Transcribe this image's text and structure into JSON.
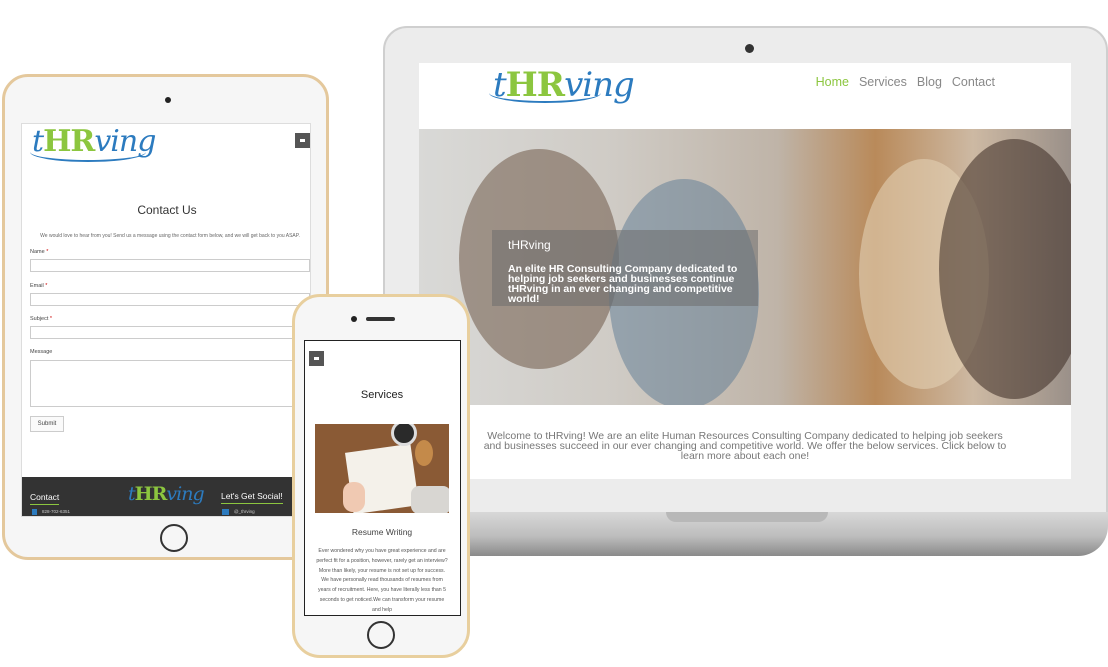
{
  "brand": {
    "logo_pre": "t",
    "logo_hr": "HR",
    "logo_post": "ving"
  },
  "laptop": {
    "nav": [
      {
        "label": "Home",
        "active": true
      },
      {
        "label": "Services",
        "active": false
      },
      {
        "label": "Blog",
        "active": false
      },
      {
        "label": "Contact",
        "active": false
      }
    ],
    "hero": {
      "title": "tHRving",
      "description": "An elite HR Consulting Company dedicated to helping job seekers and businesses continue tHRving in an ever changing and competitive world!"
    },
    "welcome": "Welcome to tHRving! We are an elite Human Resources Consulting Company dedicated to helping job seekers and businesses succeed in our ever changing and competitive world. We offer the below services. Click below to learn more about each one!"
  },
  "tablet": {
    "page_title": "Contact Us",
    "intro": "We would love to hear from you! Send us a message using the contact form below, and we will get back to you ASAP.",
    "fields": {
      "name_label": "Name",
      "email_label": "Email",
      "subject_label": "Subject",
      "message_label": "Message",
      "required_mark": "*"
    },
    "submit_label": "Submit",
    "footer": {
      "contact_heading": "Contact",
      "phone": "828-702-6351",
      "social_heading": "Let's Get Social!",
      "social_handle": "@_thrving"
    }
  },
  "phone": {
    "section_title": "Services",
    "service_name": "Resume Writing",
    "service_description": "Ever wondered why you have great experience and are perfect fit for a position, however, rarely get an interview? More than likely, your resume is not set up for success. We have personally read thousands of resumes from years of recruitment. Here, you have literally less than 5 seconds to get noticed.We can transform your resume and help"
  },
  "colors": {
    "brand_blue": "#2c7bbf",
    "brand_green": "#8cc63f",
    "footer_dark": "#333333"
  }
}
